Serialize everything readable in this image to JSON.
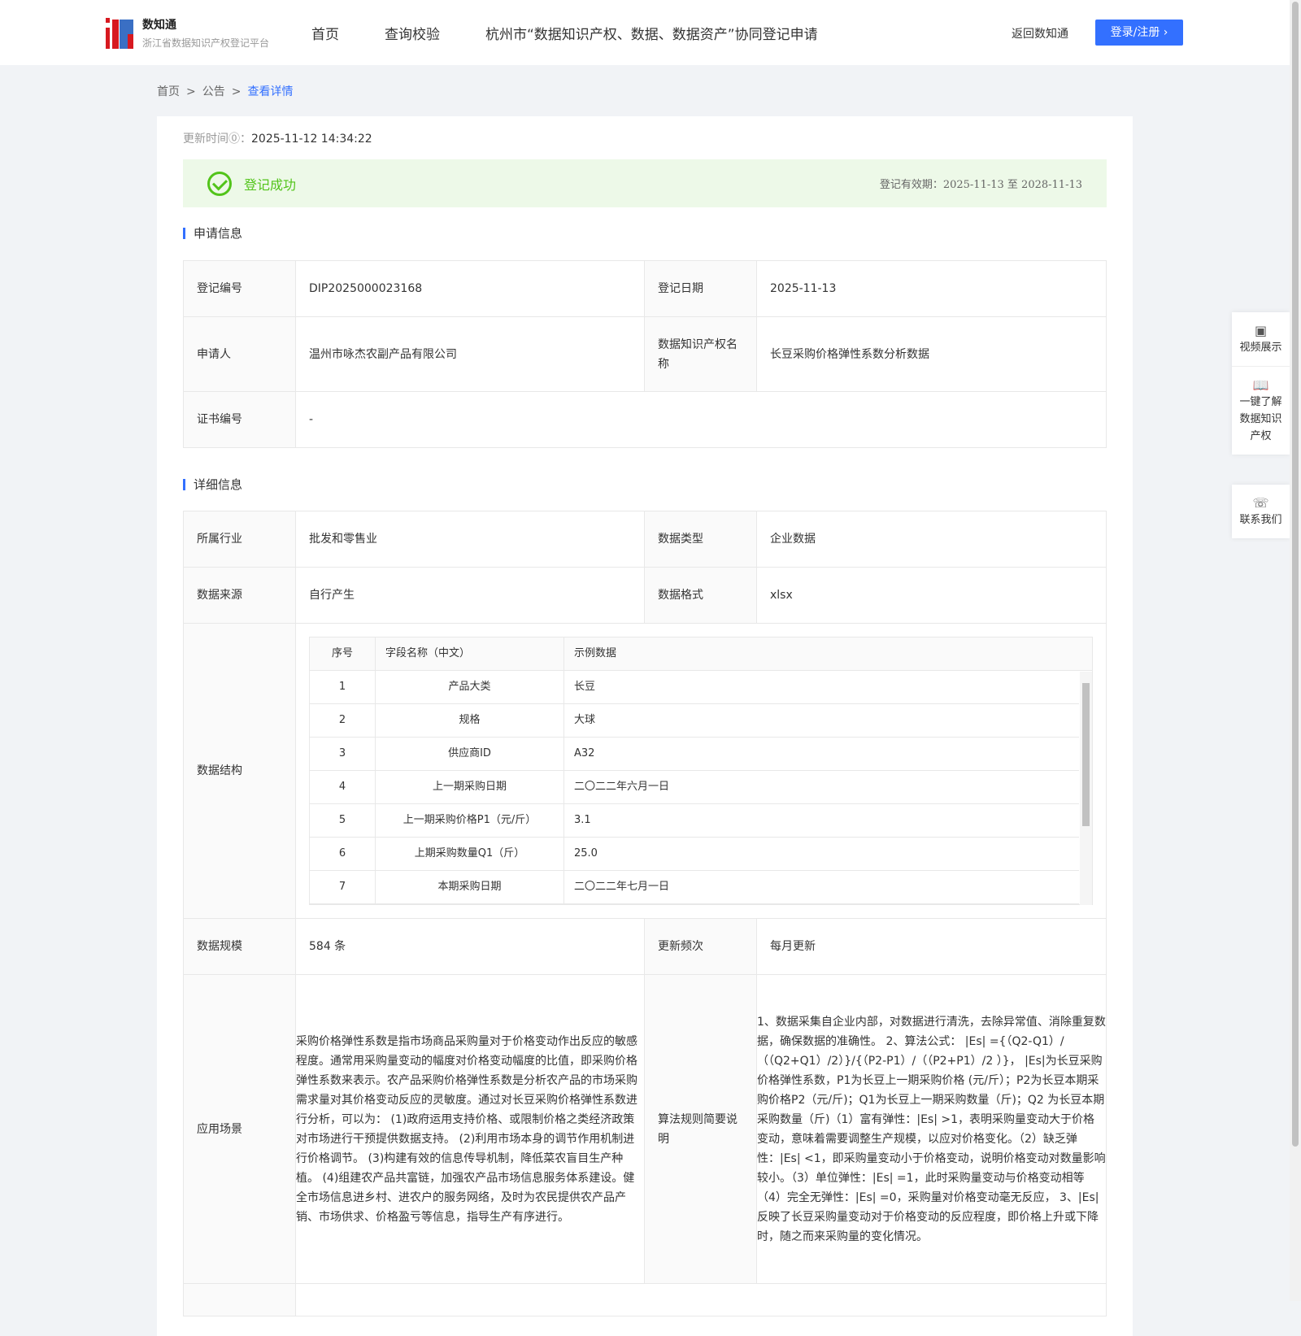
{
  "header": {
    "logo_title": "数知通",
    "logo_subtitle": "浙江省数据知识产权登记平台",
    "nav": [
      "首页",
      "查询校验",
      "杭州市“数据知识产权、数据、数据资产”协同登记申请"
    ],
    "back_link": "返回数知通",
    "login_button": "登录/注册 ›"
  },
  "breadcrumb": [
    "首页",
    "公告",
    "查看详情"
  ],
  "update": {
    "label": "更新时间⓪：",
    "value": "2025-11-12 14:34:22"
  },
  "status": {
    "text": "登记成功",
    "validity": "登记有效期：2025-11-13 至 2028-11-13"
  },
  "apply": {
    "title": "申请信息",
    "reg_no_label": "登记编号",
    "reg_no": "DIP2025000023168",
    "reg_date_label": "登记日期",
    "reg_date": "2025-11-13",
    "applicant_label": "申请人",
    "applicant": "温州市咏杰农副产品有限公司",
    "name_label": "数据知识产权名称",
    "name": "长豆采购价格弹性系数分析数据",
    "cert_label": "证书编号",
    "cert": "-"
  },
  "detail": {
    "title": "详细信息",
    "industry_label": "所属行业",
    "industry": "批发和零售业",
    "type_label": "数据类型",
    "type": "企业数据",
    "source_label": "数据来源",
    "source": "自行产生",
    "format_label": "数据格式",
    "format": "xlsx",
    "structure_label": "数据结构",
    "structure_headers": [
      "序号",
      "字段名称（中文）",
      "示例数据"
    ],
    "structure_rows": [
      [
        "1",
        "产品大类",
        "长豆"
      ],
      [
        "2",
        "规格",
        "大球"
      ],
      [
        "3",
        "供应商ID",
        "A32"
      ],
      [
        "4",
        "上一期采购日期",
        "二〇二二年六月一日"
      ],
      [
        "5",
        "上一期采购价格P1（元/斤）",
        "3.1"
      ],
      [
        "6",
        "上期采购数量Q1（斤）",
        "25.0"
      ],
      [
        "7",
        "本期采购日期",
        "二〇二二年七月一日"
      ]
    ],
    "scale_label": "数据规模",
    "scale": "584 条",
    "freq_label": "更新频次",
    "freq": "每月更新",
    "scene_label": "应用场景",
    "scene": "采购价格弹性系数是指市场商品采购量对于价格变动作出反应的敏感程度。通常用采购量变动的幅度对价格变动幅度的比值，即采购价格弹性系数来表示。农产品采购价格弹性系数是分析农产品的市场采购需求量对其价格变动反应的灵敏度。通过对长豆采购价格弹性系数进行分析，可以为： (1)政府运用支持价格、或限制价格之类经济政策对市场进行干预提供数据支持。 (2)利用市场本身的调节作用机制进行价格调节。 (3)构建有效的信息传导机制，降低菜农盲目生产种植。 (4)组建农产品共富链，加强农产品市场信息服务体系建设。健全市场信息进乡村、进农户的服务网络，及时为农民提供农产品产销、市场供求、价格盈亏等信息，指导生产有序进行。",
    "algo_label": "算法规则简要说明",
    "algo": "1、数据采集自企业内部，对数据进行清洗，去除异常值、消除重复数据，确保数据的准确性。 2、算法公式： |Es| ={（Q2-Q1）/（（Q2+Q1）/2）}/{（P2-P1）/（（P2+P1）/2 ）}， |Es|为长豆采购价格弹性系数，P1为长豆上一期采购价格 (元/斤）；P2为长豆本期采购价格P2（元/斤)；Q1为长豆上一期采购数量（斤)；Q2 为长豆本期采购数量（斤)（1）富有弹性：|Es| >1，表明采购量变动大于价格变动，意味着需要调整生产规模，以应对价格变化。（2）缺乏弹性：|Es| <1，即采购量变动小于价格变动，说明价格变动对数量影响较小。（3）单位弹性：|Es| =1，此时采购量变动与价格变动相等 （4）完全无弹性：|Es| =0，采购量对价格变动毫无反应， 3、|Es|反映了长豆采购量变动对于价格变动的反应程度，即价格上升或下降时，随之而来采购量的变化情况。"
  },
  "side": {
    "video": "视频展示",
    "learn": "一键了解数据知识产权",
    "contact": "联系我们"
  },
  "colors": {
    "accent": "#3370ff",
    "success": "#52c41a"
  }
}
